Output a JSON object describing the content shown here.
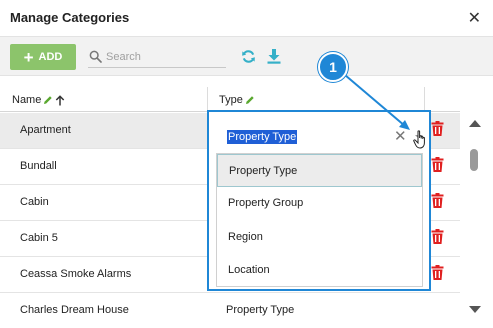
{
  "dialog": {
    "title": "Manage Categories",
    "close_glyph": "✕"
  },
  "toolbar": {
    "add_label": "ADD",
    "add_glyph": "+",
    "search_placeholder": "Search",
    "refresh_icon": "refresh-icon",
    "download_icon": "download-icon",
    "accent_color": "#8cc46b",
    "tool_color": "#35b0c8"
  },
  "grid": {
    "columns": [
      {
        "label": "Name",
        "icons": [
          "pencil-icon",
          "sort-up-icon"
        ]
      },
      {
        "label": "Type",
        "icons": [
          "pencil-icon"
        ]
      }
    ],
    "rows": [
      {
        "name": "Apartment",
        "type": "",
        "selected": true
      },
      {
        "name": "Bundall",
        "type": ""
      },
      {
        "name": "Cabin",
        "type": ""
      },
      {
        "name": "Cabin 5",
        "type": ""
      },
      {
        "name": "Ceassa Smoke Alarms",
        "type": ""
      },
      {
        "name": "Charles Dream House",
        "type": "Property Type"
      }
    ],
    "delete_icon": "trash-icon",
    "delete_color": "#e02020"
  },
  "dropdown": {
    "selected_value": "Property Type",
    "clear_glyph": "✕",
    "options": [
      "Property Type",
      "Property Group",
      "Region",
      "Location"
    ],
    "highlighted_index": 0,
    "frame_color": "#1f87d6"
  },
  "callout": {
    "number": "1",
    "color": "#1f87d6"
  }
}
